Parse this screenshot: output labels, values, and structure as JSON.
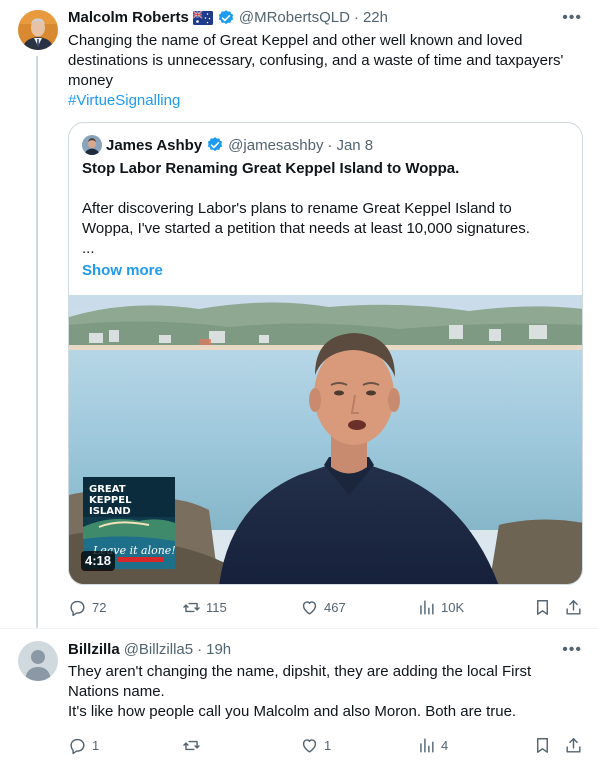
{
  "tweet1": {
    "author_name": "Malcolm Roberts",
    "flag": "🇦🇺",
    "handle": "@MRobertsQLD",
    "separator": "·",
    "time": "22h",
    "text_lines": [
      "Changing the name of Great Keppel and other well known and loved",
      "destinations is unnecessary, confusing, and a waste of time and taxpayers'",
      "money"
    ],
    "hashtag": "#VirtueSignalling",
    "quote": {
      "author_name": "James Ashby",
      "handle": "@jamesashby",
      "separator": "·",
      "date": "Jan 8",
      "title": "Stop Labor Renaming Great Keppel Island to Woppa.",
      "text_lines": [
        "After discovering Labor's plans to rename Great Keppel Island to",
        "Woppa, I've started a petition that needs at least 10,000 signatures.",
        "..."
      ],
      "show_more": "Show more",
      "video": {
        "duration": "4:18",
        "thumb_title_1": "GREAT",
        "thumb_title_2": "KEPPEL",
        "thumb_title_3": "ISLAND",
        "thumb_slogan": "Leave it alone!"
      }
    },
    "actions": {
      "replies": "72",
      "reposts": "115",
      "likes": "467",
      "views": "10K"
    }
  },
  "tweet2": {
    "author_name": "Billzilla",
    "handle": "@Billzilla5",
    "separator": "·",
    "time": "19h",
    "text_lines": [
      "They aren't changing the name, dipshit, they are adding the local First",
      "Nations name.",
      "It's like how people call you Malcolm and also Moron. Both are true."
    ],
    "actions": {
      "replies": "1",
      "reposts": "",
      "likes": "1",
      "views": "4"
    }
  },
  "colors": {
    "accent": "#1d9bf0",
    "text_primary": "#0f1419",
    "text_secondary": "#536471",
    "border": "#cfd9de"
  },
  "icons": [
    "verified-badge-icon",
    "more-options-icon",
    "reply-icon",
    "repost-icon",
    "like-icon",
    "views-icon",
    "bookmark-icon",
    "share-icon",
    "default-avatar-icon"
  ]
}
